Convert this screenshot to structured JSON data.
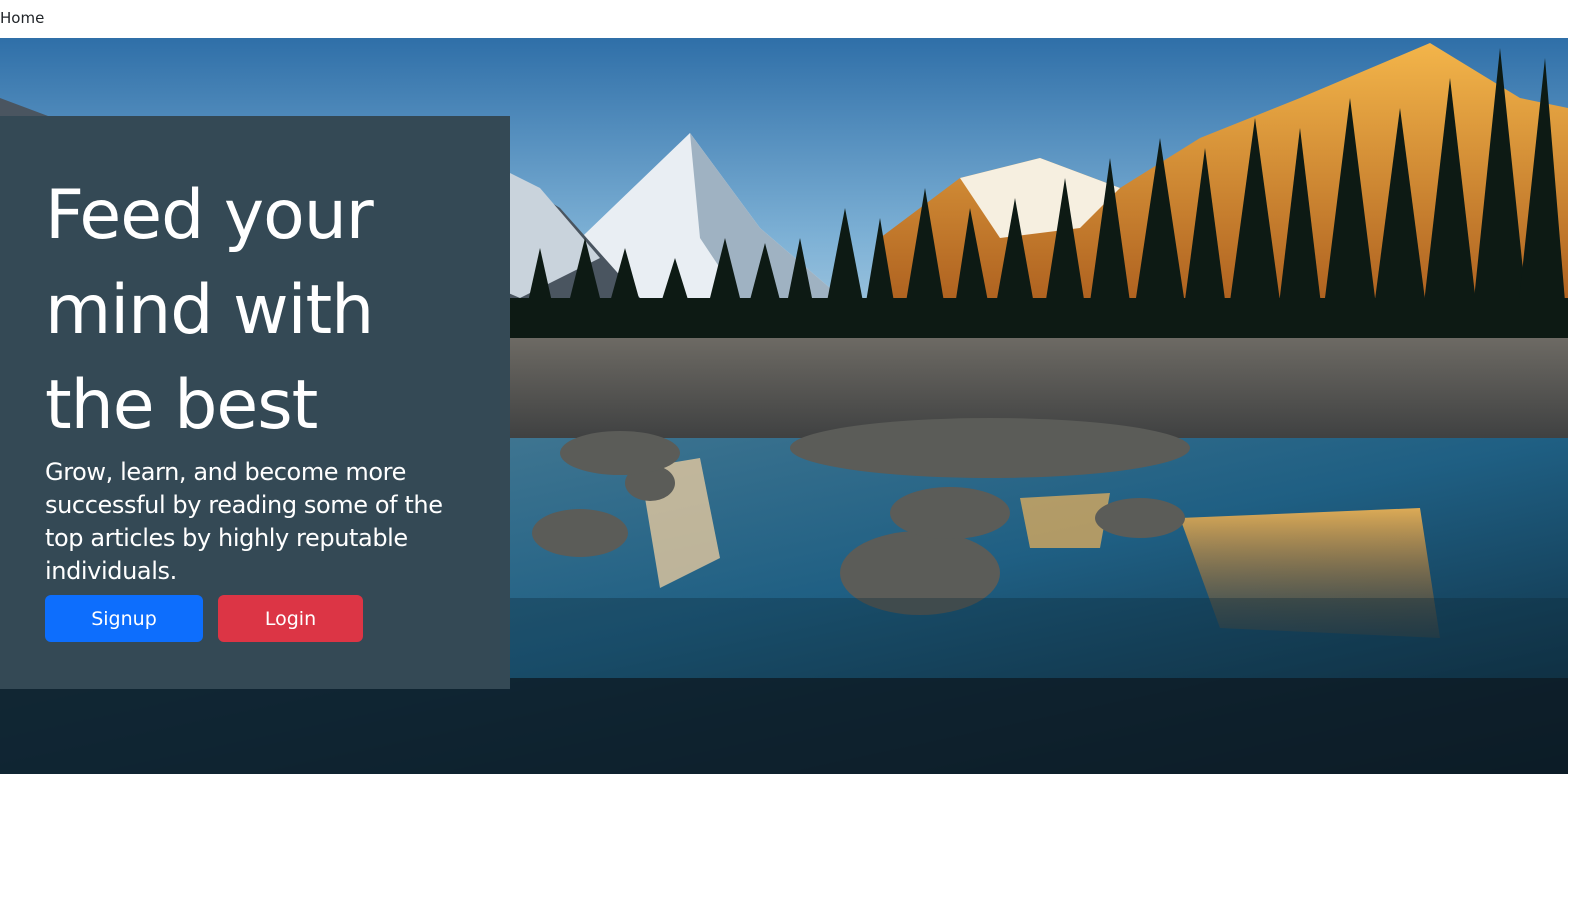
{
  "nav": {
    "home_label": "Home"
  },
  "hero": {
    "headline": "Feed your mind with the best",
    "lead": "Grow, learn, and become more successful by reading some of the top articles by highly reputable individuals.",
    "signup_label": "Signup",
    "login_label": "Login",
    "background_image": "mountain-lake-landscape",
    "colors": {
      "panel": "#344955",
      "signup": "#0d6efd",
      "login": "#dc3545"
    }
  }
}
